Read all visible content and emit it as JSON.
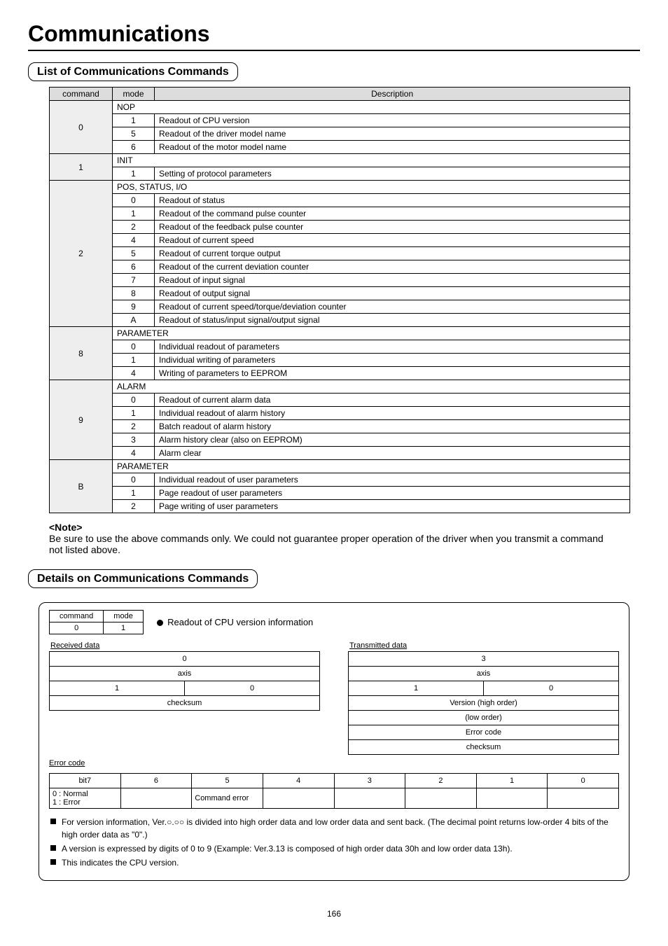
{
  "page_title": "Communications",
  "section1": "List of Communications Commands",
  "cmdlist": {
    "headers": [
      "command",
      "mode",
      "Description"
    ],
    "groups": [
      {
        "cmd": "0",
        "title": "NOP",
        "rows": [
          {
            "mode": "1",
            "desc": "Readout of CPU version"
          },
          {
            "mode": "5",
            "desc": "Readout of the driver model name"
          },
          {
            "mode": "6",
            "desc": "Readout of the motor model name"
          }
        ]
      },
      {
        "cmd": "1",
        "title": "INIT",
        "rows": [
          {
            "mode": "1",
            "desc": "Setting of protocol parameters"
          }
        ]
      },
      {
        "cmd": "2",
        "title": "POS, STATUS, I/O",
        "rows": [
          {
            "mode": "0",
            "desc": "Readout of status"
          },
          {
            "mode": "1",
            "desc": "Readout of the command pulse counter"
          },
          {
            "mode": "2",
            "desc": "Readout of the feedback pulse counter"
          },
          {
            "mode": "4",
            "desc": "Readout of current speed"
          },
          {
            "mode": "5",
            "desc": "Readout of current torque output"
          },
          {
            "mode": "6",
            "desc": "Readout of the current deviation counter"
          },
          {
            "mode": "7",
            "desc": "Readout of input signal"
          },
          {
            "mode": "8",
            "desc": "Readout of output signal"
          },
          {
            "mode": "9",
            "desc": "Readout of current speed/torque/deviation counter"
          },
          {
            "mode": "A",
            "desc": "Readout of status/input signal/output signal"
          }
        ]
      },
      {
        "cmd": "8",
        "title": "PARAMETER",
        "rows": [
          {
            "mode": "0",
            "desc": "Individual readout of parameters"
          },
          {
            "mode": "1",
            "desc": "Individual writing of parameters"
          },
          {
            "mode": "4",
            "desc": "Writing of parameters to EEPROM"
          }
        ]
      },
      {
        "cmd": "9",
        "title": "ALARM",
        "rows": [
          {
            "mode": "0",
            "desc": "Readout of current alarm data"
          },
          {
            "mode": "1",
            "desc": "Individual readout of alarm history"
          },
          {
            "mode": "2",
            "desc": "Batch readout of alarm history"
          },
          {
            "mode": "3",
            "desc": "Alarm history clear (also on EEPROM)"
          },
          {
            "mode": "4",
            "desc": "Alarm clear"
          }
        ]
      },
      {
        "cmd": "B",
        "title": "PARAMETER",
        "rows": [
          {
            "mode": "0",
            "desc": "Individual readout of user parameters"
          },
          {
            "mode": "1",
            "desc": "Page readout of user parameters"
          },
          {
            "mode": "2",
            "desc": "Page writing of user parameters"
          }
        ]
      }
    ]
  },
  "note": {
    "heading": "<Note>",
    "body": "Be sure to use the above commands only.  We could not guarantee proper operation of the driver when you transmit a command not listed above."
  },
  "section2": "Details on Communications Commands",
  "card": {
    "hdr": {
      "cmd_label": "command",
      "cmd_val": "0",
      "mode_label": "mode",
      "mode_val": "1"
    },
    "title": "Readout of CPU version information",
    "recv_label": "Received data",
    "trans_label": "Transmitted data",
    "recv": {
      "r1": "0",
      "r2": "axis",
      "r3a": "1",
      "r3b": "0",
      "r4": "checksum"
    },
    "trans": {
      "r1": "3",
      "r2": "axis",
      "r3a": "1",
      "r3b": "0",
      "r4": "Version (high order)",
      "r5": "(low order)",
      "r6": "Error code",
      "r7": "checksum"
    },
    "err": {
      "caption": "Error code",
      "cols": [
        "bit7",
        "6",
        "5",
        "4",
        "3",
        "2",
        "1",
        "0"
      ],
      "labels": {
        "left": "0 : Normal\n1 : Error",
        "c5": "Command error"
      }
    },
    "bullets": [
      "For version information, Ver.○.○○ is divided into high order data and low order data and sent back. (The decimal point returns low-order 4 bits of the high order data as \"0\".)",
      "A version is expressed by digits of 0 to 9 (Example: Ver.3.13 is composed of high order data 30h and low order data 13h).",
      "This indicates the CPU version."
    ]
  },
  "pagenum": "166"
}
